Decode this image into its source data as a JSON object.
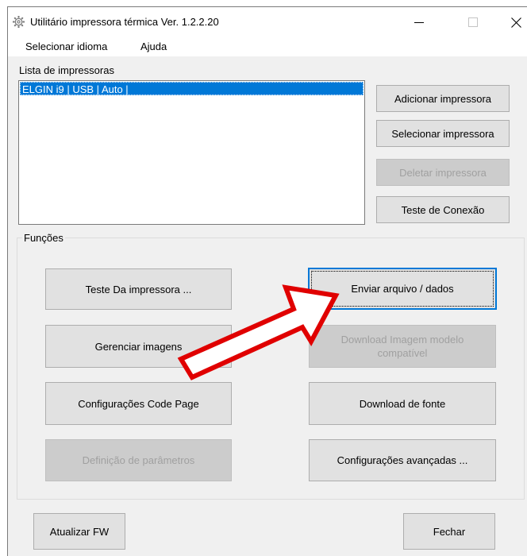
{
  "window": {
    "title": "Utilitário impressora térmica Ver. 1.2.2.20"
  },
  "menu": {
    "language": "Selecionar idioma",
    "help": "Ajuda"
  },
  "printers": {
    "section_label": "Lista de impressoras",
    "items": [
      "ELGIN i9 | USB | Auto |"
    ],
    "selected_index": 0
  },
  "printer_buttons": {
    "add": "Adicionar impressora",
    "select": "Selecionar impressora",
    "delete": "Deletar impressora",
    "test_connection": "Teste de Conexão"
  },
  "functions": {
    "group_label": "Funções",
    "printer_test": "Teste Da impressora ...",
    "send_file": "Enviar arquivo / dados",
    "manage_images": "Gerenciar imagens",
    "download_template_image": "Download Imagem modelo compatível",
    "code_page_settings": "Configurações Code Page",
    "download_font": "Download de fonte",
    "parameter_definition": "Definição de parâmetros",
    "advanced_settings": "Configurações avançadas ..."
  },
  "footer": {
    "update_fw": "Atualizar FW",
    "close": "Fechar"
  },
  "colors": {
    "selection": "#0078d7",
    "annotation_arrow": "#e00000"
  }
}
